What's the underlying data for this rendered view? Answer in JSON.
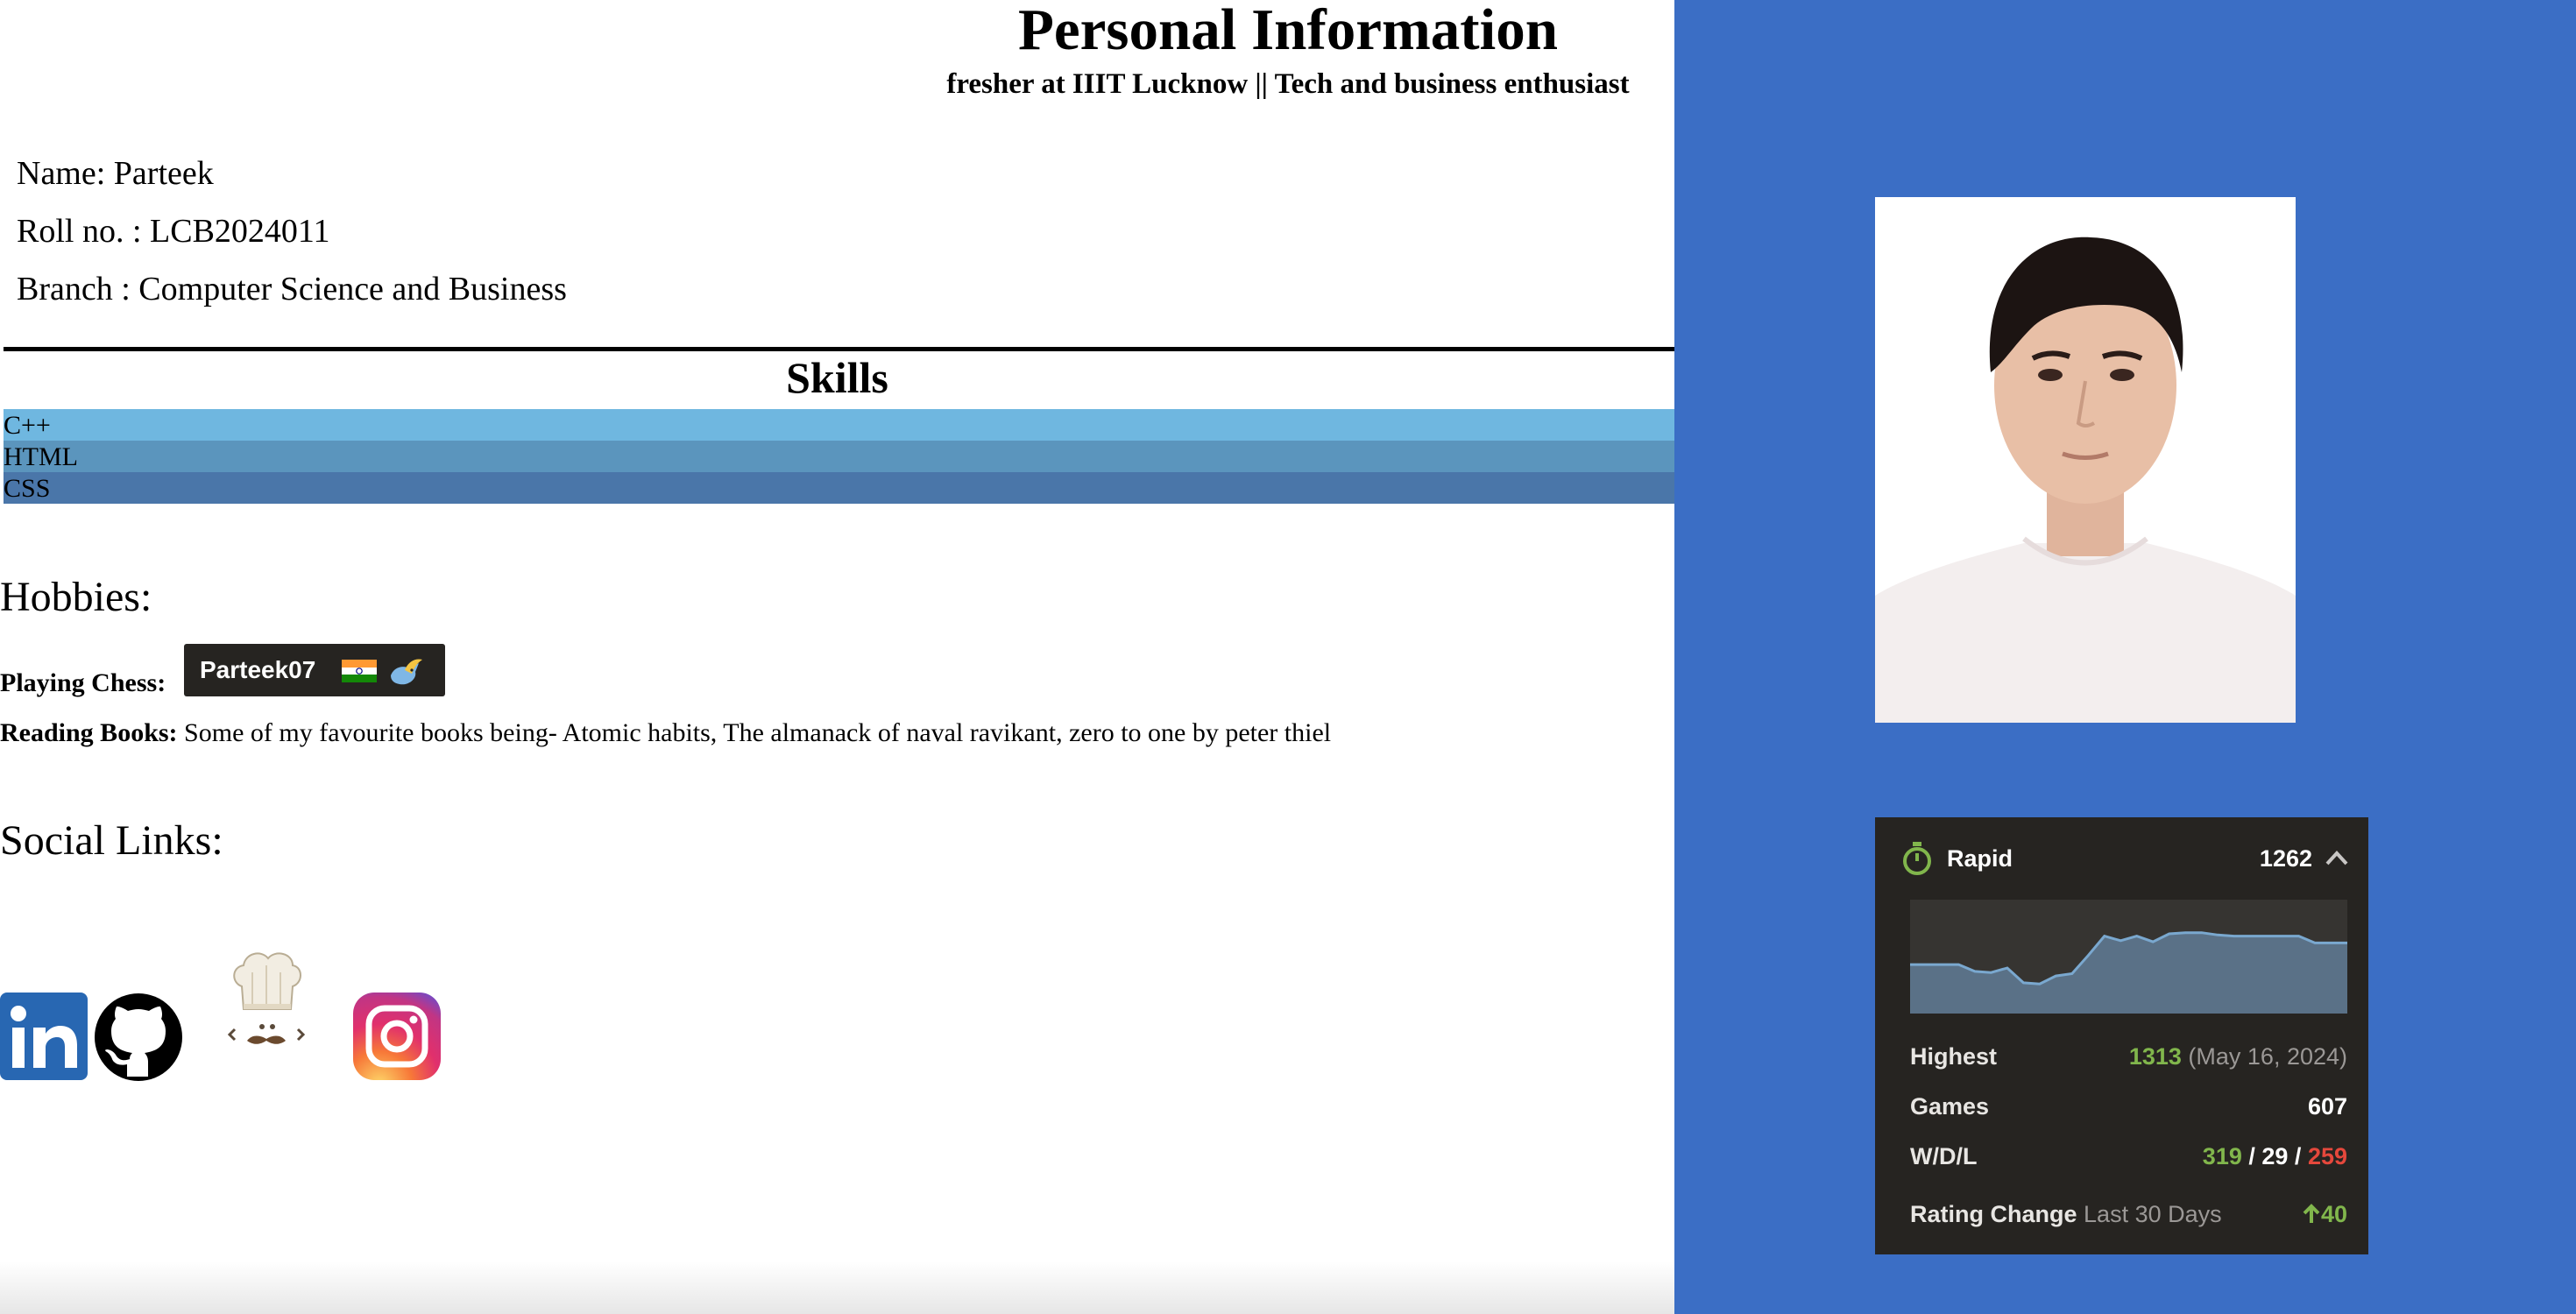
{
  "header": {
    "title": "Personal Information",
    "subtitle": "fresher at IIIT Lucknow || Tech and business enthusiast"
  },
  "personal": {
    "name": "Name: Parteek",
    "roll": "Roll no. : LCB2024011",
    "branch": "Branch : Computer Science and Business"
  },
  "skills": {
    "title": "Skills",
    "items": [
      {
        "label": "C++",
        "color": "#6fb7e0"
      },
      {
        "label": "HTML",
        "color": "#5b95bd"
      },
      {
        "label": "CSS",
        "color": "#4a76a9"
      }
    ]
  },
  "hobbies": {
    "heading": "Hobbies:",
    "chess_label": "Playing Chess:",
    "chess_username": "Parteek07",
    "reading_label": "Reading Books:",
    "reading_text": " Some of my favourite books being- Atomic habits, The almanack of naval ravikant, zero to one by peter thiel"
  },
  "social": {
    "heading": "Social Links:",
    "icons": [
      "linkedin-icon",
      "github-icon",
      "codechef-icon",
      "instagram-icon"
    ]
  },
  "chess_card": {
    "mode": "Rapid",
    "rating": "1262",
    "highest_label": "Highest",
    "highest_value": "1313",
    "highest_date": "(May 16, 2024)",
    "games_label": "Games",
    "games_value": "607",
    "wdl_label": "W/D/L",
    "wins": "319",
    "draws": "29",
    "losses": "259",
    "separator": " / ",
    "change_label": "Rating Change",
    "change_period": "Last 30 Days",
    "change_value": "40",
    "rating_history": [
      1243,
      1243,
      1243,
      1243,
      1237,
      1236,
      1240,
      1227,
      1226,
      1233,
      1235,
      1251,
      1268,
      1264,
      1268,
      1263,
      1270,
      1271,
      1271,
      1269,
      1268,
      1268,
      1268,
      1268,
      1268,
      1262,
      1262,
      1262
    ],
    "accent_colors": {
      "win": "#81b64c",
      "loss": "#e5483c"
    }
  },
  "colors": {
    "sidebar_bg": "#3b6ec5"
  }
}
